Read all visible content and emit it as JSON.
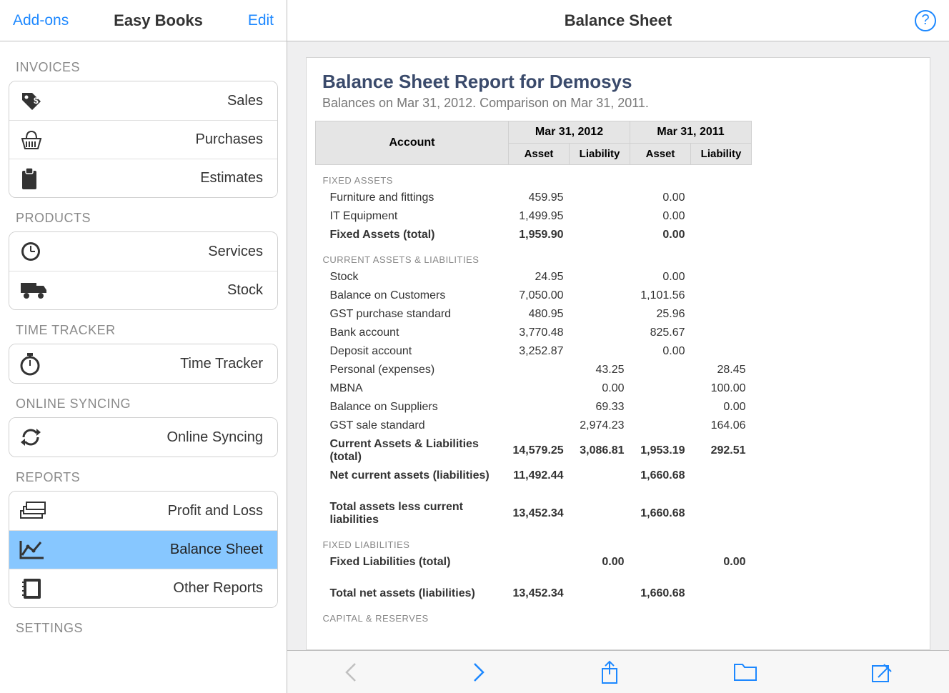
{
  "sidebar": {
    "addons": "Add-ons",
    "title": "Easy Books",
    "edit": "Edit",
    "sections": [
      {
        "label": "INVOICES",
        "items": [
          {
            "id": "sales",
            "label": "Sales",
            "icon": "tag-icon"
          },
          {
            "id": "purchases",
            "label": "Purchases",
            "icon": "basket-icon"
          },
          {
            "id": "estimates",
            "label": "Estimates",
            "icon": "clipboard-icon"
          }
        ]
      },
      {
        "label": "PRODUCTS",
        "items": [
          {
            "id": "services",
            "label": "Services",
            "icon": "clock-icon"
          },
          {
            "id": "stock",
            "label": "Stock",
            "icon": "truck-icon"
          }
        ]
      },
      {
        "label": "TIME TRACKER",
        "items": [
          {
            "id": "timetracker",
            "label": "Time Tracker",
            "icon": "stopwatch-icon"
          }
        ]
      },
      {
        "label": "ONLINE SYNCING",
        "items": [
          {
            "id": "syncing",
            "label": "Online Syncing",
            "icon": "sync-icon"
          }
        ]
      },
      {
        "label": "REPORTS",
        "items": [
          {
            "id": "pl",
            "label": "Profit and Loss",
            "icon": "money-stack-icon"
          },
          {
            "id": "balance",
            "label": "Balance Sheet",
            "icon": "chart-line-icon",
            "selected": true
          },
          {
            "id": "other",
            "label": "Other Reports",
            "icon": "notebook-icon"
          }
        ]
      },
      {
        "label": "SETTINGS",
        "items": []
      }
    ]
  },
  "main": {
    "header_title": "Balance Sheet",
    "report_title": "Balance Sheet Report for Demosys",
    "report_subtitle": "Balances on Mar 31, 2012. Comparison on Mar 31, 2011.",
    "table": {
      "account_header": "Account",
      "dates": [
        "Mar 31, 2012",
        "Mar 31, 2011"
      ],
      "subcols": [
        "Asset",
        "Liability",
        "Asset",
        "Liability"
      ],
      "rows": [
        {
          "type": "section",
          "label": "FIXED ASSETS"
        },
        {
          "label": "Furniture and fittings",
          "v": [
            "459.95",
            "",
            "0.00",
            ""
          ]
        },
        {
          "label": "IT Equipment",
          "v": [
            "1,499.95",
            "",
            "0.00",
            ""
          ]
        },
        {
          "label": "Fixed Assets (total)",
          "v": [
            "1,959.90",
            "",
            "0.00",
            ""
          ],
          "bold": true
        },
        {
          "type": "section",
          "label": "CURRENT ASSETS & LIABILITIES"
        },
        {
          "label": "Stock",
          "v": [
            "24.95",
            "",
            "0.00",
            ""
          ]
        },
        {
          "label": "Balance on Customers",
          "v": [
            "7,050.00",
            "",
            "1,101.56",
            ""
          ]
        },
        {
          "label": "GST purchase standard",
          "v": [
            "480.95",
            "",
            "25.96",
            ""
          ]
        },
        {
          "label": "Bank account",
          "v": [
            "3,770.48",
            "",
            "825.67",
            ""
          ]
        },
        {
          "label": "Deposit account",
          "v": [
            "3,252.87",
            "",
            "0.00",
            ""
          ]
        },
        {
          "label": "Personal (expenses)",
          "v": [
            "",
            "43.25",
            "",
            "28.45"
          ]
        },
        {
          "label": "MBNA",
          "v": [
            "",
            "0.00",
            "",
            "100.00"
          ]
        },
        {
          "label": "Balance on Suppliers",
          "v": [
            "",
            "69.33",
            "",
            "0.00"
          ]
        },
        {
          "label": "GST sale standard",
          "v": [
            "",
            "2,974.23",
            "",
            "164.06"
          ]
        },
        {
          "label": "Current Assets & Liabilities (total)",
          "v": [
            "14,579.25",
            "3,086.81",
            "1,953.19",
            "292.51"
          ],
          "bold": true
        },
        {
          "label": "Net current assets (liabilities)",
          "v": [
            "11,492.44",
            "",
            "1,660.68",
            ""
          ],
          "bold": true
        },
        {
          "type": "space"
        },
        {
          "label": "Total assets less current liabilities",
          "v": [
            "13,452.34",
            "",
            "1,660.68",
            ""
          ],
          "bold": true
        },
        {
          "type": "section",
          "label": "FIXED LIABILITIES"
        },
        {
          "label": "Fixed Liabilities (total)",
          "v": [
            "",
            "0.00",
            "",
            "0.00"
          ],
          "bold": true
        },
        {
          "type": "space"
        },
        {
          "label": "Total net assets (liabilities)",
          "v": [
            "13,452.34",
            "",
            "1,660.68",
            ""
          ],
          "bold": true
        },
        {
          "type": "section",
          "label": "CAPITAL & RESERVES"
        }
      ]
    }
  },
  "toolbar": {
    "back": "back",
    "forward": "forward",
    "share": "share",
    "folder": "folder",
    "compose": "compose"
  }
}
